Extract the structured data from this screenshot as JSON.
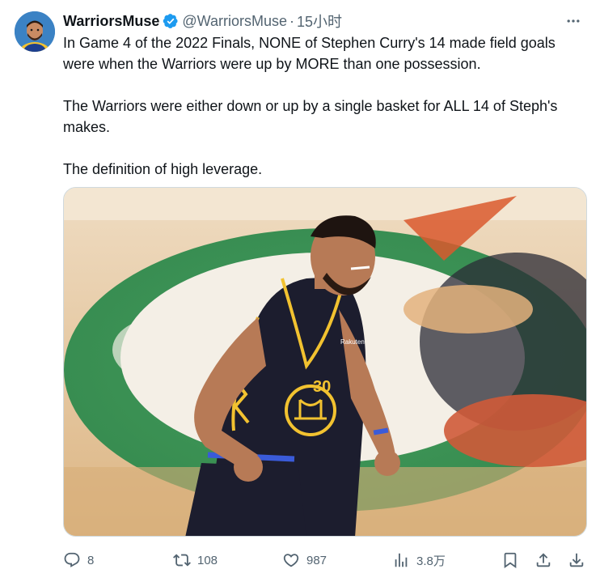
{
  "tweet": {
    "display_name": "WarriorsMuse",
    "handle": "@WarriorsMuse",
    "separator": "·",
    "time": "15小时",
    "paragraphs": [
      "In Game 4 of the 2022 Finals, NONE of Stephen Curry's 14 made field goals were when the Warriors were up by MORE than one possession.",
      "The Warriors were either down or up by a single basket for ALL 14 of Steph's makes.",
      "The definition of high leverage."
    ],
    "image": {
      "jersey_number": "30",
      "jersey_brand": "Rakuten"
    }
  },
  "actions": {
    "reply_count": "8",
    "retweet_count": "108",
    "like_count": "987",
    "view_count": "3.8万"
  },
  "icons": {
    "verified": "verified-badge-icon",
    "more": "more-icon",
    "reply": "reply-icon",
    "retweet": "retweet-icon",
    "like": "like-icon",
    "views": "views-icon",
    "bookmark": "bookmark-icon",
    "share": "share-icon",
    "download": "download-icon"
  },
  "colors": {
    "verified": "#1d9bf0",
    "text": "#0f1419",
    "secondary": "#536471",
    "jersey": "#1c1d2e",
    "jersey_trim": "#f2c230",
    "court_green": "#2f8a4d",
    "court_wood": "#e6c69c"
  }
}
